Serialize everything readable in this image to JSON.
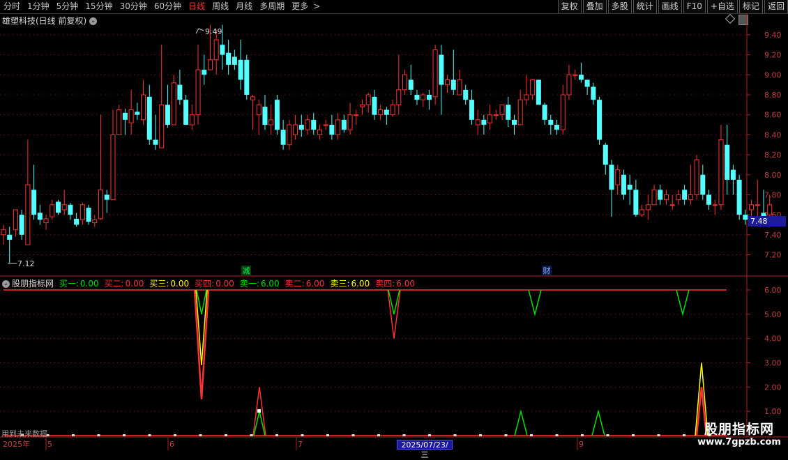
{
  "toolbar": {
    "periods": [
      {
        "label": "分时",
        "active": false
      },
      {
        "label": "1分钟",
        "active": false
      },
      {
        "label": "5分钟",
        "active": false
      },
      {
        "label": "15分钟",
        "active": false
      },
      {
        "label": "30分钟",
        "active": false
      },
      {
        "label": "60分钟",
        "active": false
      },
      {
        "label": "日线",
        "active": true
      },
      {
        "label": "周线",
        "active": false
      },
      {
        "label": "月线",
        "active": false
      },
      {
        "label": "多周期",
        "active": false
      },
      {
        "label": "更多",
        "active": false
      }
    ],
    "buttons": [
      "复权",
      "叠加",
      "多股",
      "统计",
      "画线",
      "F10",
      "+自选",
      "标记",
      "返回"
    ]
  },
  "stock": {
    "title": "雄塑科技(日线 前复权)"
  },
  "price_axis": [
    "9.40",
    "9.20",
    "9.00",
    "8.80",
    "8.60",
    "8.40",
    "8.20",
    "8.00",
    "7.80",
    "7.60",
    "7.40",
    "7.20"
  ],
  "current_price": "7.48",
  "high_label": "9.49",
  "low_label": "7.12",
  "markers": {
    "reduce": "减",
    "finance": "财"
  },
  "indicator": {
    "name": "股朋指标网",
    "values": [
      {
        "label": "买一:",
        "value": "0.00",
        "color": "#00e000"
      },
      {
        "label": "买二:",
        "value": "0.00",
        "color": "#ff3030"
      },
      {
        "label": "买三:",
        "value": "0.00",
        "color": "#ffff00"
      },
      {
        "label": "买四:",
        "value": "0.00",
        "color": "#ff3030"
      },
      {
        "label": "卖一:",
        "value": "6.00",
        "color": "#00e000"
      },
      {
        "label": "卖二:",
        "value": "6.00",
        "color": "#ff3030"
      },
      {
        "label": "卖三:",
        "value": "6.00",
        "color": "#ffff00"
      },
      {
        "label": "卖四:",
        "value": "6.00",
        "color": "#ff3030"
      }
    ],
    "axis": [
      "6.00",
      "5.00",
      "4.00",
      "3.00",
      "2.00",
      "1.00"
    ]
  },
  "time_axis": {
    "year": "2025年",
    "months": [
      "5",
      "6",
      "7",
      "9"
    ],
    "cursor_date": "2025/07/23/三"
  },
  "future_note": "用到未来数据",
  "watermark": {
    "line1": "股朋指标网",
    "line2": "www.7gpzb.com"
  },
  "chart_data": {
    "type": "candlestick",
    "ylim": [
      7.1,
      9.55
    ],
    "candles": [
      [
        7.4,
        7.45,
        7.3,
        7.5
      ],
      [
        7.4,
        7.35,
        7.12,
        7.48
      ],
      [
        7.45,
        7.65,
        7.38,
        7.65
      ],
      [
        7.6,
        7.4,
        7.35,
        7.65
      ],
      [
        7.3,
        7.9,
        7.3,
        8.35
      ],
      [
        7.85,
        7.6,
        7.55,
        8.1
      ],
      [
        7.62,
        7.55,
        7.5,
        7.7
      ],
      [
        7.52,
        7.56,
        7.45,
        7.6
      ],
      [
        7.58,
        7.7,
        7.55,
        7.75
      ],
      [
        7.73,
        7.62,
        7.6,
        7.75
      ],
      [
        7.65,
        7.7,
        7.6,
        7.85
      ],
      [
        7.7,
        7.6,
        7.55,
        7.72
      ],
      [
        7.56,
        7.5,
        7.48,
        7.62
      ],
      [
        7.55,
        7.7,
        7.5,
        7.72
      ],
      [
        7.67,
        7.53,
        7.5,
        7.7
      ],
      [
        7.52,
        7.55,
        7.48,
        7.6
      ],
      [
        7.56,
        7.85,
        7.55,
        8.6
      ],
      [
        7.8,
        7.75,
        7.62,
        7.85
      ],
      [
        7.75,
        8.4,
        7.75,
        8.65
      ],
      [
        8.4,
        8.65,
        8.4,
        8.7
      ],
      [
        8.62,
        8.55,
        8.4,
        8.66
      ],
      [
        8.52,
        8.65,
        8.4,
        8.85
      ],
      [
        8.63,
        8.6,
        8.55,
        8.72
      ],
      [
        8.55,
        8.8,
        8.5,
        8.95
      ],
      [
        8.78,
        8.35,
        8.3,
        8.9
      ],
      [
        8.35,
        8.3,
        8.25,
        8.6
      ],
      [
        8.27,
        8.7,
        8.3,
        9.3
      ],
      [
        8.7,
        8.5,
        8.47,
        8.9
      ],
      [
        8.5,
        8.92,
        8.5,
        9.0
      ],
      [
        8.9,
        8.75,
        8.7,
        9.05
      ],
      [
        8.75,
        8.5,
        8.5,
        8.8
      ],
      [
        8.5,
        8.6,
        8.45,
        8.7
      ],
      [
        8.6,
        9.05,
        8.5,
        9.3
      ],
      [
        9.05,
        9.0,
        8.9,
        9.2
      ],
      [
        9.05,
        9.15,
        9.05,
        9.5
      ],
      [
        9.15,
        9.35,
        9.0,
        9.45
      ],
      [
        9.3,
        9.2,
        9.05,
        9.5
      ],
      [
        9.22,
        9.1,
        9.0,
        9.35
      ],
      [
        9.18,
        9.1,
        9.05,
        9.25
      ],
      [
        9.15,
        8.95,
        8.85,
        9.35
      ],
      [
        9.15,
        8.8,
        8.75,
        9.2
      ],
      [
        8.75,
        8.78,
        8.45,
        8.8
      ],
      [
        8.6,
        8.7,
        8.4,
        8.75
      ],
      [
        8.68,
        8.5,
        8.45,
        8.8
      ],
      [
        8.5,
        8.55,
        8.4,
        8.7
      ],
      [
        8.75,
        8.45,
        8.4,
        8.8
      ],
      [
        8.45,
        8.3,
        8.25,
        8.55
      ],
      [
        8.3,
        8.5,
        8.25,
        8.55
      ],
      [
        8.4,
        8.5,
        8.35,
        8.6
      ],
      [
        8.5,
        8.45,
        8.38,
        8.6
      ],
      [
        8.45,
        8.55,
        8.4,
        8.6
      ],
      [
        8.55,
        8.45,
        8.4,
        8.62
      ],
      [
        8.4,
        8.45,
        8.35,
        8.5
      ],
      [
        8.5,
        8.5,
        8.45,
        8.55
      ],
      [
        8.5,
        8.4,
        8.35,
        8.6
      ],
      [
        8.4,
        8.55,
        8.35,
        8.62
      ],
      [
        8.55,
        8.45,
        8.42,
        8.6
      ],
      [
        8.45,
        8.6,
        8.4,
        8.72
      ],
      [
        8.6,
        8.6,
        8.5,
        8.65
      ],
      [
        8.68,
        8.7,
        8.6,
        8.75
      ],
      [
        8.7,
        8.8,
        8.62,
        8.82
      ],
      [
        8.78,
        8.6,
        8.55,
        8.85
      ],
      [
        8.6,
        8.65,
        8.55,
        8.7
      ],
      [
        8.65,
        8.6,
        8.5,
        8.68
      ],
      [
        8.6,
        8.7,
        8.58,
        8.75
      ],
      [
        8.7,
        8.85,
        8.6,
        9.2
      ],
      [
        8.85,
        9.0,
        8.8,
        9.05
      ],
      [
        8.95,
        8.85,
        8.8,
        9.1
      ],
      [
        8.8,
        8.75,
        8.7,
        8.85
      ],
      [
        8.75,
        8.8,
        8.68,
        8.82
      ],
      [
        8.8,
        8.75,
        8.65,
        8.85
      ],
      [
        8.78,
        9.25,
        8.7,
        9.3
      ],
      [
        9.2,
        8.9,
        8.6,
        9.3
      ],
      [
        8.9,
        8.95,
        8.82,
        9.0
      ],
      [
        8.95,
        8.85,
        8.8,
        9.25
      ],
      [
        8.8,
        8.95,
        8.8,
        9.05
      ],
      [
        8.85,
        8.75,
        8.7,
        8.9
      ],
      [
        8.75,
        8.55,
        8.5,
        8.85
      ],
      [
        8.5,
        8.55,
        8.4,
        8.65
      ],
      [
        8.55,
        8.5,
        8.4,
        8.6
      ],
      [
        8.52,
        8.6,
        8.45,
        8.7
      ],
      [
        8.6,
        8.6,
        8.55,
        8.65
      ],
      [
        8.6,
        8.7,
        8.55,
        8.7
      ],
      [
        8.7,
        8.55,
        8.48,
        8.78
      ],
      [
        8.55,
        8.5,
        8.4,
        8.6
      ],
      [
        8.5,
        8.75,
        8.5,
        8.85
      ],
      [
        8.75,
        8.8,
        8.7,
        9.0
      ],
      [
        8.8,
        8.95,
        8.75,
        8.95
      ],
      [
        8.95,
        8.7,
        8.7,
        8.95
      ],
      [
        8.7,
        8.55,
        8.5,
        8.72
      ],
      [
        8.55,
        8.5,
        8.4,
        8.6
      ],
      [
        8.5,
        8.45,
        8.4,
        8.55
      ],
      [
        8.45,
        8.8,
        8.4,
        8.9
      ],
      [
        8.8,
        9.0,
        8.75,
        9.1
      ],
      [
        9.0,
        9.0,
        8.95,
        9.05
      ],
      [
        9.0,
        8.95,
        8.92,
        9.12
      ],
      [
        8.95,
        8.88,
        8.8,
        8.95
      ],
      [
        8.88,
        8.75,
        8.7,
        8.92
      ],
      [
        8.75,
        8.35,
        8.3,
        8.78
      ],
      [
        8.3,
        8.1,
        8.0,
        8.32
      ],
      [
        8.1,
        7.85,
        7.58,
        8.15
      ],
      [
        7.9,
        8.05,
        7.8,
        8.1
      ],
      [
        8.0,
        7.8,
        7.75,
        8.05
      ],
      [
        7.9,
        7.85,
        7.7,
        8.0
      ],
      [
        7.85,
        7.6,
        7.58,
        7.95
      ],
      [
        7.6,
        7.65,
        7.58,
        7.7
      ],
      [
        7.65,
        7.7,
        7.55,
        7.8
      ],
      [
        7.7,
        7.85,
        7.7,
        7.9
      ],
      [
        7.85,
        7.75,
        7.7,
        7.9
      ],
      [
        7.75,
        7.8,
        7.7,
        7.85
      ],
      [
        7.7,
        7.7,
        7.65,
        7.8
      ],
      [
        7.75,
        7.8,
        7.7,
        7.85
      ],
      [
        7.85,
        7.75,
        7.7,
        7.9
      ],
      [
        7.75,
        7.8,
        7.7,
        8.1
      ],
      [
        7.8,
        8.15,
        7.75,
        8.2
      ],
      [
        8.0,
        7.8,
        7.75,
        8.1
      ],
      [
        7.8,
        7.7,
        7.65,
        7.85
      ],
      [
        7.7,
        7.7,
        7.6,
        7.75
      ],
      [
        7.7,
        8.35,
        7.65,
        8.5
      ],
      [
        8.3,
        7.95,
        7.8,
        8.5
      ],
      [
        8.05,
        7.95,
        7.8,
        8.1
      ],
      [
        7.95,
        7.6,
        7.55,
        8.0
      ],
      [
        7.6,
        7.55,
        7.5,
        7.65
      ],
      [
        7.65,
        7.7,
        7.55,
        7.75
      ],
      [
        7.7,
        7.7,
        7.5,
        7.95
      ],
      [
        7.62,
        7.58,
        7.52,
        7.85
      ],
      [
        7.6,
        7.7,
        7.55,
        7.8
      ]
    ]
  }
}
